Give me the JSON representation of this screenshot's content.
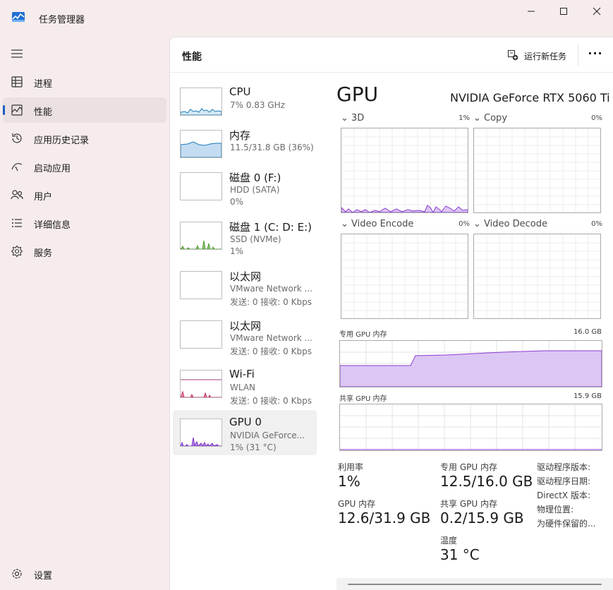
{
  "window": {
    "title": "任务管理器",
    "icon": "task-manager-icon"
  },
  "sidebar": {
    "items": [
      {
        "label": "进程",
        "icon": "processes-icon",
        "active": false
      },
      {
        "label": "性能",
        "icon": "performance-icon",
        "active": true
      },
      {
        "label": "应用历史记录",
        "icon": "app-history-icon",
        "active": false
      },
      {
        "label": "启动应用",
        "icon": "startup-apps-icon",
        "active": false
      },
      {
        "label": "用户",
        "icon": "users-icon",
        "active": false
      },
      {
        "label": "详细信息",
        "icon": "details-icon",
        "active": false
      },
      {
        "label": "服务",
        "icon": "services-icon",
        "active": false
      }
    ],
    "settings_label": "设置"
  },
  "header": {
    "title": "性能",
    "run_task_label": "运行新任务",
    "more_label": "···"
  },
  "devices": [
    {
      "name": "CPU",
      "sub": "7%  0.83 GHz",
      "value": "",
      "color": "#1a7bb5",
      "fill": "#d5e8f4",
      "selected": false
    },
    {
      "name": "内存",
      "sub": "11.5/31.8 GB (36%)",
      "value": "",
      "color": "#1a7bb5",
      "fill": "#c4dcf2",
      "selected": false
    },
    {
      "name": "磁盘 0 (F:)",
      "sub": "HDD (SATA)",
      "value": "0%",
      "color": "#4d9a2e",
      "fill": "#e3f0dc",
      "selected": false
    },
    {
      "name": "磁盘 1 (C: D: E:)",
      "sub": "SSD (NVMe)",
      "value": "1%",
      "color": "#4d9a2e",
      "fill": "#e3f0dc",
      "selected": false
    },
    {
      "name": "以太网",
      "sub": "VMware Network ...",
      "value": "发送: 0  接收: 0 Kbps",
      "color": "#a43c7a",
      "fill": "#f4dcec",
      "selected": false
    },
    {
      "name": "以太网",
      "sub": "VMware Network ...",
      "value": "发送: 0  接收: 0 Kbps",
      "color": "#a43c7a",
      "fill": "#f4dcec",
      "selected": false
    },
    {
      "name": "Wi-Fi",
      "sub": "WLAN",
      "value": "发送: 0  接收: 0 Kbps",
      "color": "#a43c7a",
      "fill": "#f4dcec",
      "selected": false
    },
    {
      "name": "GPU 0",
      "sub": "NVIDIA GeForce...",
      "value": "1% (31 °C)",
      "color": "#7a2fc9",
      "fill": "#e9dcf8",
      "selected": true
    }
  ],
  "gpu": {
    "title": "GPU",
    "model": "NVIDIA GeForce RTX 5060 Ti",
    "accent_color": "#8a3cd0",
    "engines": [
      {
        "name": "3D",
        "pct": "1%"
      },
      {
        "name": "Copy",
        "pct": "0%"
      },
      {
        "name": "Video Encode",
        "pct": "0%"
      },
      {
        "name": "Video Decode",
        "pct": "0%"
      }
    ],
    "dedicated_memory": {
      "label": "专用 GPU 内存",
      "max": "16.0 GB"
    },
    "shared_memory": {
      "label": "共享 GPU 内存",
      "max": "15.9 GB"
    },
    "stats": {
      "utilization_label": "利用率",
      "utilization_value": "1%",
      "dedicated_label": "专用 GPU 内存",
      "dedicated_value": "12.5/16.0 GB",
      "gpu_memory_label": "GPU 内存",
      "gpu_memory_value": "12.6/31.9 GB",
      "shared_label": "共享 GPU 内存",
      "shared_value": "0.2/15.9 GB",
      "temperature_label": "温度",
      "temperature_value": "31 °C"
    },
    "info_labels": [
      "驱动程序版本:",
      "驱动程序日期:",
      "DirectX 版本:",
      "物理位置:",
      "为硬件保留的..."
    ]
  }
}
